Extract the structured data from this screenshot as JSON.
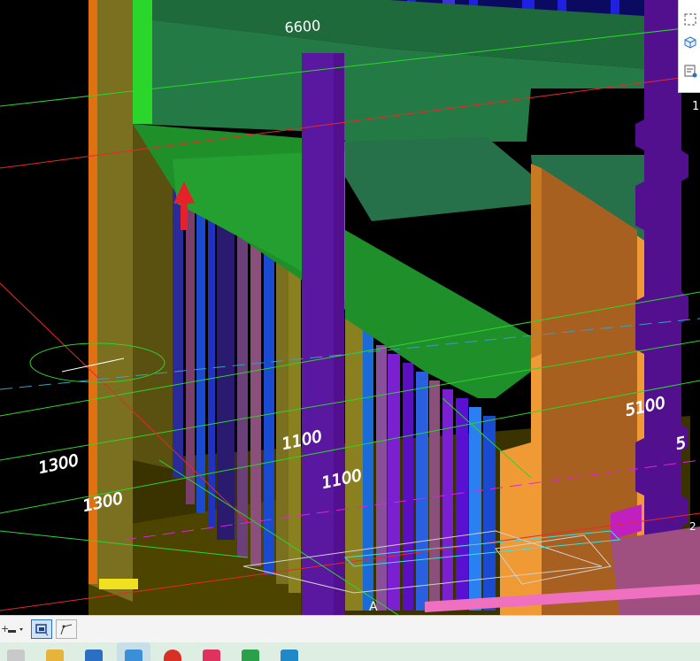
{
  "viewport": {
    "dimensions": [
      {
        "name": "dim-6600",
        "text": "6600"
      },
      {
        "name": "dim-1300-a",
        "text": "1300"
      },
      {
        "name": "dim-1300-b",
        "text": "1300"
      },
      {
        "name": "dim-1100-a",
        "text": "1100"
      },
      {
        "name": "dim-1100-b",
        "text": "1100"
      },
      {
        "name": "dim-5100-a",
        "text": "5100"
      },
      {
        "name": "dim-5100-b",
        "text": "5"
      }
    ],
    "grid_label": "A",
    "edge_labels": {
      "top": "1",
      "bottom": "2"
    },
    "colors": {
      "background": "#000000",
      "beam_green": "#1f8f2a",
      "slab_green": "#26704a",
      "column_purple": "#52108f",
      "wall_orange": "#f09a35",
      "wall_olive": "#7a7020",
      "red_arrow": "#e8202a"
    }
  },
  "right_panel": {
    "buttons": [
      {
        "icon": "selection-frame-icon"
      },
      {
        "icon": "3d-cube-icon"
      },
      {
        "icon": "layer-list-icon"
      }
    ]
  },
  "statusbar": {
    "buttons": [
      {
        "icon": "snap-settings-icon"
      },
      {
        "icon": "select-mode-icon",
        "active": true
      },
      {
        "icon": "polyline-icon"
      }
    ]
  },
  "taskbar": {
    "apps": [
      {
        "icon": "file-app-icon",
        "color": "#c9c9c9"
      },
      {
        "icon": "folder-icon",
        "color": "#e8b33a"
      },
      {
        "icon": "app-calendar-icon",
        "color": "#2a6fc4"
      },
      {
        "icon": "active-app-icon",
        "color": "#3a8fd8"
      },
      {
        "icon": "chrome-icon",
        "color": "#d93025"
      },
      {
        "icon": "app-pink-icon",
        "color": "#e0325f"
      },
      {
        "icon": "app-green-icon",
        "color": "#2aa04a"
      },
      {
        "icon": "app-info-icon",
        "color": "#1e88c8"
      }
    ]
  }
}
